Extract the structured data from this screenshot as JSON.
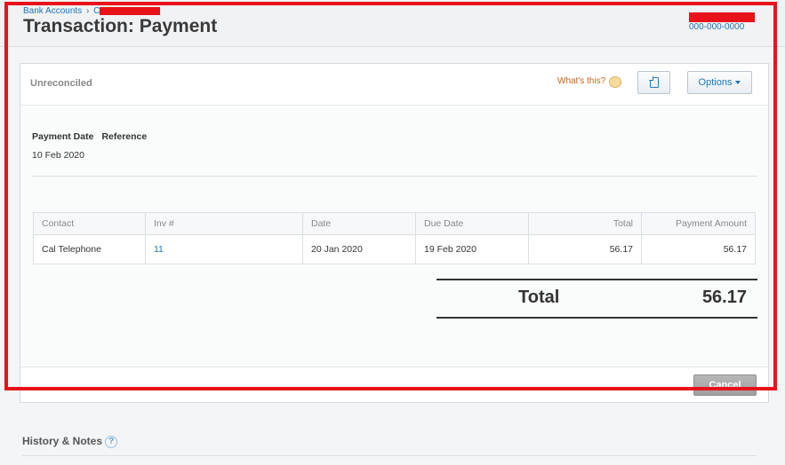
{
  "header": {
    "breadcrumb": {
      "bank_accounts": "Bank Accounts",
      "separator": "›",
      "current_initial": "C"
    },
    "title": "Transaction: Payment",
    "account_number": "000-000-0000"
  },
  "panel": {
    "status": "Unreconciled",
    "whats_this": "What's this?",
    "options_label": "Options",
    "fields": {
      "payment_date_label": "Payment Date",
      "reference_label": "Reference",
      "payment_date_value": "10 Feb 2020"
    },
    "table": {
      "columns": [
        "Contact",
        "Inv #",
        "Date",
        "Due Date",
        "Total",
        "Payment Amount"
      ],
      "rows": [
        [
          "Cal Telephone",
          "11",
          "20 Jan 2020",
          "19 Feb 2020",
          "56.17",
          "56.17"
        ]
      ]
    },
    "total_label": "Total",
    "total_value": "56.17",
    "cancel_label": "Cancel"
  },
  "history": {
    "title": "History & Notes",
    "help": "?"
  },
  "colors": {
    "accent": "#1f74b8",
    "highlight": "#e8121a",
    "link_orange": "#c8611c"
  },
  "icons": {
    "whats_this": "speech-bubble-icon",
    "copy": "copy-icon",
    "options": "chevron-down-icon",
    "help": "help-icon"
  }
}
